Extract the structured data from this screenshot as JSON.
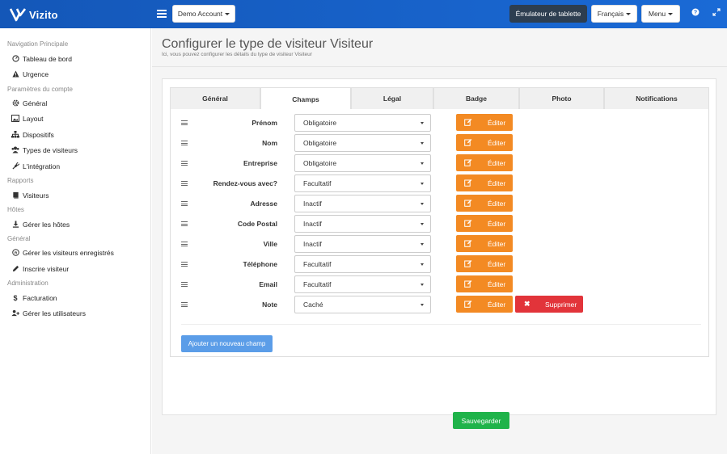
{
  "brand": {
    "name": "Vizito"
  },
  "topbar": {
    "account_label": "Demo Account",
    "tablet_label": "Émulateur de tablette",
    "language_label": "Français",
    "menu_label": "Menu",
    "help_icon": "question-icon",
    "fullscreen_icon": "expand-icon"
  },
  "sidebar": {
    "sections": [
      {
        "heading": "Navigation Principale",
        "items": [
          {
            "label": "Tableau de bord",
            "icon": "gauge-icon"
          },
          {
            "label": "Urgence",
            "icon": "warning-icon"
          }
        ]
      },
      {
        "heading": "Paramètres du compte",
        "items": [
          {
            "label": "Général",
            "icon": "gear-icon"
          },
          {
            "label": "Layout",
            "icon": "image-icon"
          },
          {
            "label": "Dispositifs",
            "icon": "sitemap-icon"
          },
          {
            "label": "Types de visiteurs",
            "icon": "users-icon"
          },
          {
            "label": "L'intégration",
            "icon": "plug-icon"
          }
        ]
      },
      {
        "heading": "Rapports",
        "items": [
          {
            "label": "Visiteurs",
            "icon": "book-icon"
          }
        ]
      },
      {
        "heading": "Hôtes",
        "items": [
          {
            "label": "Gérer les hôtes",
            "icon": "download-icon"
          }
        ]
      },
      {
        "heading": "Général",
        "items": [
          {
            "label": "Gérer les visiteurs enregistrés",
            "icon": "registered-icon"
          },
          {
            "label": "Inscrire visiteur",
            "icon": "pencil-icon"
          }
        ]
      },
      {
        "heading": "Administration",
        "items": [
          {
            "label": "Facturation",
            "icon": "dollar-icon"
          },
          {
            "label": "Gérer les utilisateurs",
            "icon": "user-plus-icon"
          }
        ]
      }
    ]
  },
  "page": {
    "title": "Configurer le type de visiteur Visiteur",
    "subtitle": "Ici, vous pouvez configurer les détails du type de visiteur Visiteur"
  },
  "tabs": [
    {
      "label": "Général",
      "active": false
    },
    {
      "label": "Champs",
      "active": true
    },
    {
      "label": "Légal",
      "active": false
    },
    {
      "label": "Badge",
      "active": false
    },
    {
      "label": "Photo",
      "active": false
    },
    {
      "label": "Notifications",
      "active": false
    }
  ],
  "fields": [
    {
      "label": "Prénom",
      "value": "Obligatoire",
      "deletable": false
    },
    {
      "label": "Nom",
      "value": "Obligatoire",
      "deletable": false
    },
    {
      "label": "Entreprise",
      "value": "Obligatoire",
      "deletable": false
    },
    {
      "label": "Rendez-vous avec?",
      "value": "Facultatif",
      "deletable": false
    },
    {
      "label": "Adresse",
      "value": "Inactif",
      "deletable": false
    },
    {
      "label": "Code Postal",
      "value": "Inactif",
      "deletable": false
    },
    {
      "label": "Ville",
      "value": "Inactif",
      "deletable": false
    },
    {
      "label": "Téléphone",
      "value": "Facultatif",
      "deletable": false
    },
    {
      "label": "Email",
      "value": "Facultatif",
      "deletable": false
    },
    {
      "label": "Note",
      "value": "Caché",
      "deletable": true
    }
  ],
  "actions": {
    "edit_label": "Éditer",
    "delete_label": "Supprimer",
    "add_field_label": "Ajouter un nouveau champ",
    "save_label": "Sauvegarder"
  },
  "colors": {
    "topbar": "#1a6ad6",
    "edit": "#f38a23",
    "delete": "#e2343a",
    "add": "#5b9de8",
    "save": "#1fb34a"
  }
}
